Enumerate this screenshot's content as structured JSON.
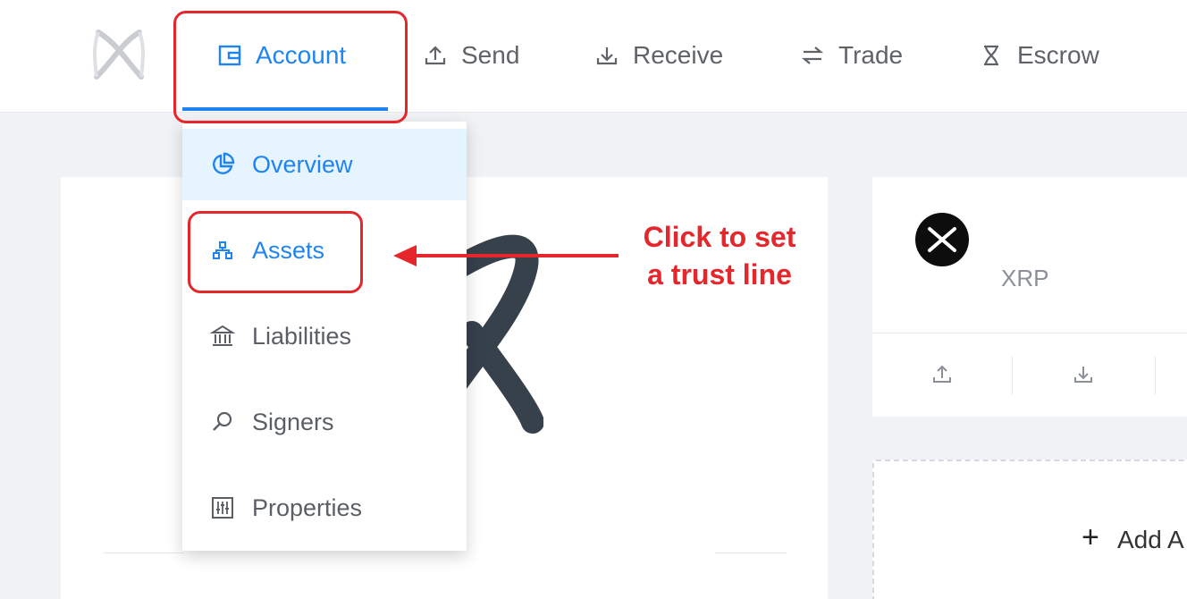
{
  "nav": {
    "items": [
      {
        "label": "Account",
        "icon": "wallet-icon",
        "active": true
      },
      {
        "label": "Send",
        "icon": "upload-icon"
      },
      {
        "label": "Receive",
        "icon": "download-icon"
      },
      {
        "label": "Trade",
        "icon": "swap-icon"
      },
      {
        "label": "Escrow",
        "icon": "hourglass-icon"
      }
    ]
  },
  "account_menu": {
    "items": [
      {
        "label": "Overview",
        "icon": "pie-chart-icon",
        "state": "selected"
      },
      {
        "label": "Assets",
        "icon": "cluster-icon",
        "state": "highlighted"
      },
      {
        "label": "Liabilities",
        "icon": "bank-icon"
      },
      {
        "label": "Signers",
        "icon": "key-icon"
      },
      {
        "label": "Properties",
        "icon": "sliders-icon"
      }
    ]
  },
  "asset_card": {
    "name": "XRP",
    "icon": "xrp-logo-icon"
  },
  "add_card": {
    "label": "Add A"
  },
  "annotation": {
    "line1": "Click to set",
    "line2": "a trust line"
  },
  "colors": {
    "accent": "#1f84f0",
    "annotation": "#e5262b",
    "menu_selected_bg": "#e6f4ff"
  }
}
